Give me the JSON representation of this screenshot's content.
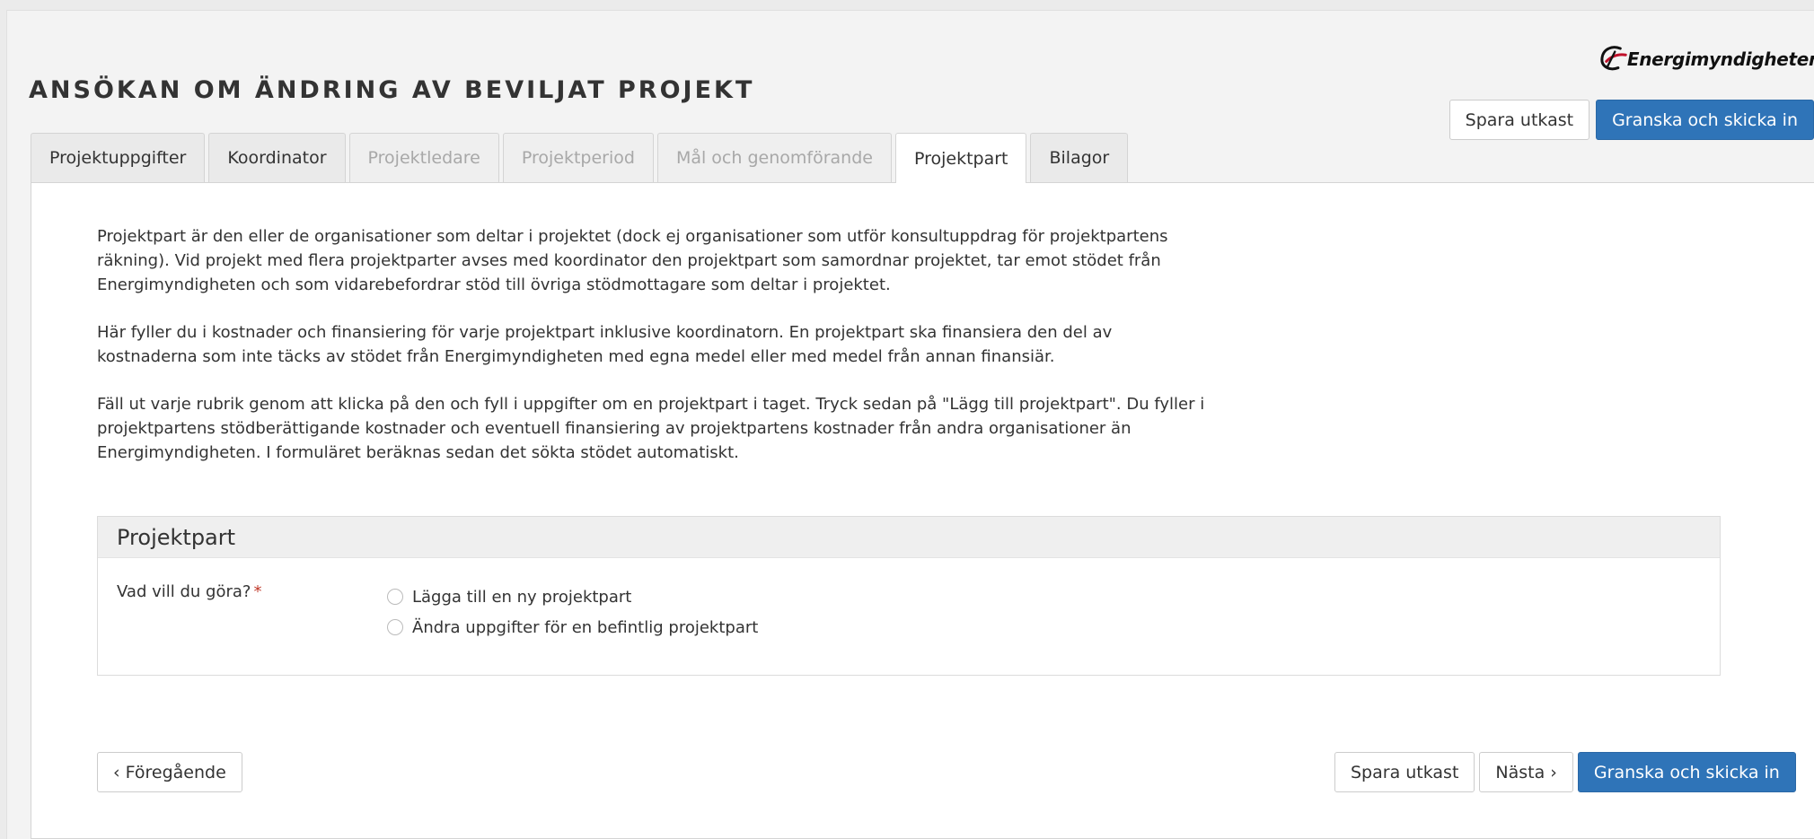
{
  "brand": {
    "logo_text": "Energimyndigheten",
    "accent_color": "#2f74b8",
    "logo_swoosh_color": "#c0102a"
  },
  "page": {
    "title": "ANSÖKAN OM ÄNDRING AV BEVILJAT PROJEKT"
  },
  "top_actions": {
    "save_draft": "Spara utkast",
    "review_submit": "Granska och skicka in"
  },
  "tabs": [
    {
      "label": "Projektuppgifter",
      "state": "enabled"
    },
    {
      "label": "Koordinator",
      "state": "enabled"
    },
    {
      "label": "Projektledare",
      "state": "disabled"
    },
    {
      "label": "Projektperiod",
      "state": "disabled"
    },
    {
      "label": "Mål och genomförande",
      "state": "disabled"
    },
    {
      "label": "Projektpart",
      "state": "active"
    },
    {
      "label": "Bilagor",
      "state": "enabled"
    }
  ],
  "intro": {
    "p1": "Projektpart är den eller de organisationer som deltar i projektet (dock ej organisationer som utför konsultuppdrag för projektpartens räkning). Vid projekt med flera projektparter avses med koordinator den projektpart som samordnar projektet, tar emot stödet från Energimyndigheten och som vidarebefordrar stöd till övriga stödmottagare som deltar i projektet.",
    "p2": "Här fyller du i kostnader och finansiering för varje projektpart inklusive koordinatorn. En projektpart ska finansiera den del av kostnaderna som inte täcks av stödet från Energimyndigheten med egna medel eller med medel från annan finansiär.",
    "p3": "Fäll ut varje rubrik genom att klicka på den och fyll i uppgifter om en projektpart i taget. Tryck sedan på \"Lägg till projektpart\". Du fyller i projektpartens stödberättigande kostnader och eventuell finansiering av projektpartens kostnader från andra organisationer än Energimyndigheten. I formuläret beräknas sedan det sökta stödet automatiskt."
  },
  "section": {
    "title": "Projektpart",
    "question": "Vad vill du göra?",
    "required_mark": "*",
    "options": [
      {
        "label": "Lägga till en ny projektpart",
        "checked": false
      },
      {
        "label": "Ändra uppgifter för en befintlig projektpart",
        "checked": false
      }
    ]
  },
  "bottom_nav": {
    "previous": "‹ Föregående",
    "save_draft": "Spara utkast",
    "next": "Nästa ›",
    "review_submit": "Granska och skicka in"
  }
}
